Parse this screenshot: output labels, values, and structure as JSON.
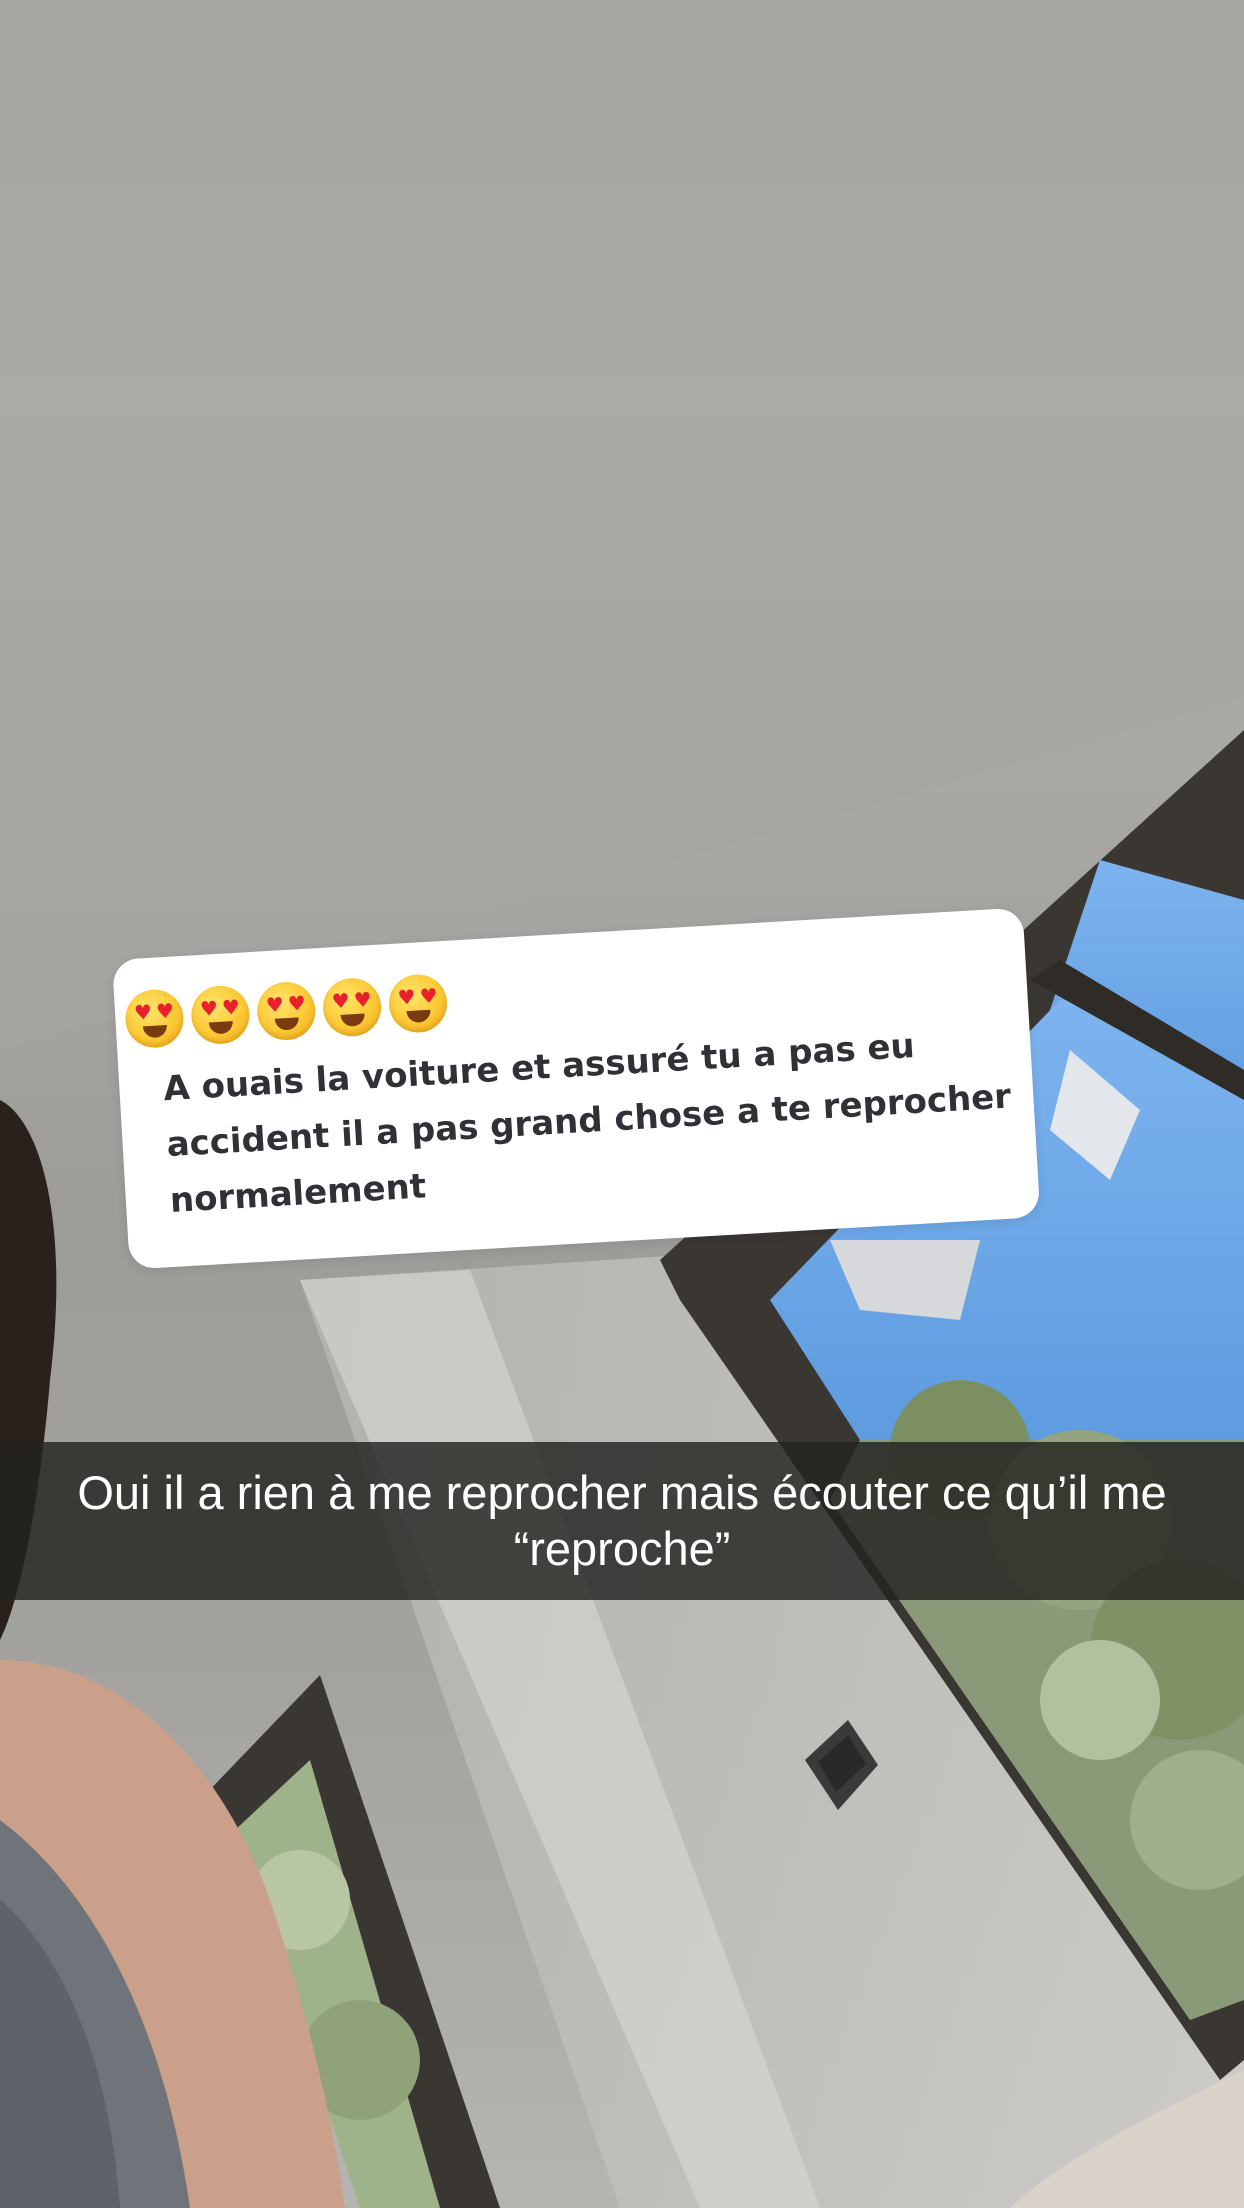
{
  "reply_card": {
    "emojis": [
      "heart-eyes-face",
      "heart-eyes-face",
      "heart-eyes-face",
      "heart-eyes-face",
      "heart-eyes-face"
    ],
    "text": "A ouais la voiture et assuré tu a pas eu accident il a pas grand chose a te reprocher normalement"
  },
  "caption": {
    "text": "Oui il a rien à me reprocher mais écouter ce qu’il me “reproche”"
  },
  "colors": {
    "card_background": "#ffffff",
    "card_text": "#2e3136",
    "caption_bar": "#222220",
    "caption_text": "#ffffff",
    "sky": "#6aa6e6",
    "window_frame": "#3a3733"
  }
}
